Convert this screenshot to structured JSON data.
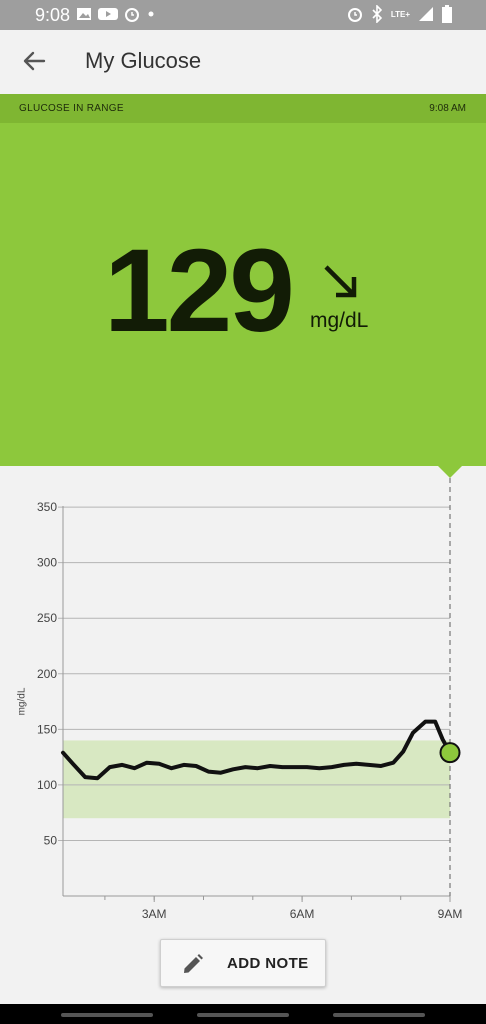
{
  "status": {
    "time": "9:08",
    "network": "LTE+"
  },
  "icons": {
    "left": [
      "image-icon",
      "youtube-icon",
      "alarm-icon",
      "dot-icon"
    ],
    "right": [
      "alarm-icon",
      "bluetooth-icon",
      "signal-icon",
      "battery-icon"
    ]
  },
  "appbar": {
    "title": "My Glucose"
  },
  "banner": {
    "status": "GLUCOSE IN RANGE",
    "time": "9:08 AM",
    "color": "#8dc83c"
  },
  "reading": {
    "value": "129",
    "unit": "mg/dL",
    "trend": "falling-slowly"
  },
  "chart_data": {
    "type": "line",
    "ylabel": "mg/dL",
    "ylim": [
      0,
      360
    ],
    "y_ticks": [
      50,
      100,
      150,
      200,
      250,
      300,
      350
    ],
    "x_ticks": [
      {
        "label": "3AM",
        "t": 3
      },
      {
        "label": "6AM",
        "t": 6
      },
      {
        "label": "9AM",
        "t": 9
      }
    ],
    "xlim": [
      1.15,
      9.25
    ],
    "target_range": [
      70,
      140
    ],
    "current": {
      "t": 9.0,
      "value": 129
    },
    "series": [
      {
        "points": [
          [
            1.15,
            129
          ],
          [
            1.35,
            119
          ],
          [
            1.6,
            107
          ],
          [
            1.85,
            106
          ],
          [
            2.1,
            116
          ],
          [
            2.35,
            118
          ],
          [
            2.6,
            115
          ],
          [
            2.85,
            120
          ],
          [
            3.1,
            119
          ],
          [
            3.35,
            115
          ],
          [
            3.6,
            118
          ],
          [
            3.85,
            117
          ],
          [
            4.1,
            112
          ],
          [
            4.35,
            111
          ],
          [
            4.6,
            114
          ],
          [
            4.85,
            116
          ],
          [
            5.1,
            115
          ],
          [
            5.35,
            117
          ],
          [
            5.6,
            116
          ],
          [
            5.85,
            116
          ],
          [
            6.1,
            116
          ],
          [
            6.35,
            115
          ],
          [
            6.6,
            116
          ],
          [
            6.85,
            118
          ],
          [
            7.1,
            119
          ],
          [
            7.35,
            118
          ],
          [
            7.6,
            117
          ],
          [
            7.85,
            120
          ],
          [
            8.05,
            130
          ],
          [
            8.25,
            147
          ],
          [
            8.5,
            157
          ],
          [
            8.7,
            157
          ],
          [
            8.85,
            141
          ],
          [
            9.0,
            129
          ]
        ]
      }
    ]
  },
  "actions": {
    "add_note": "ADD NOTE"
  }
}
